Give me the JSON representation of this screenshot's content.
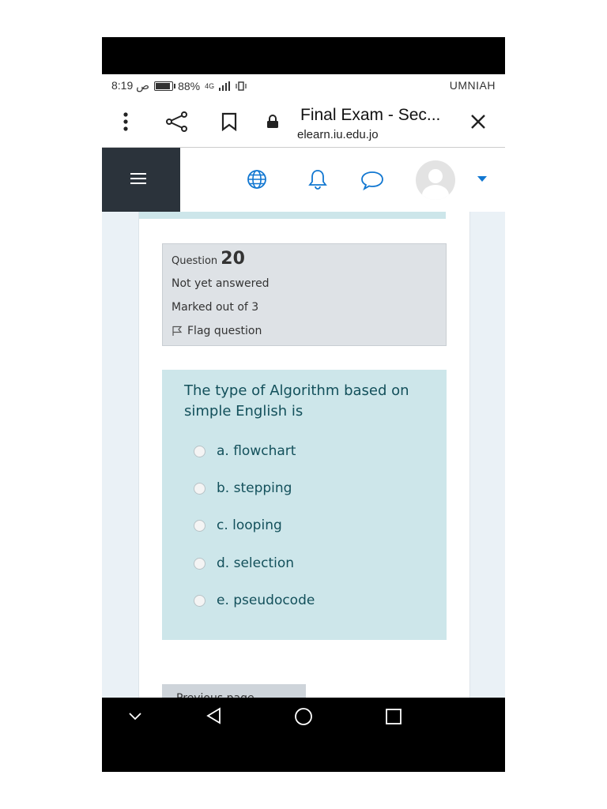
{
  "status_bar": {
    "time": "8:19 ص",
    "battery": "88%",
    "battery_level": 0.88,
    "network": "4G",
    "carrier": "UMNIAH"
  },
  "browser": {
    "page_title": "Final Exam - Sec...",
    "host": "elearn.iu.edu.jo",
    "icons": [
      "more-vert-icon",
      "share-icon",
      "bookmark-icon",
      "lock-icon",
      "close-icon"
    ]
  },
  "moodle_nav": {
    "icons": [
      "menu-icon",
      "globe-icon",
      "bell-icon",
      "chat-icon",
      "avatar",
      "caret-down-icon"
    ],
    "accent": "#1177d1"
  },
  "question": {
    "label": "Question",
    "number": "20",
    "state": "Not yet answered",
    "marks": "Marked out of 3",
    "flag": "Flag question",
    "text": "The type of Algorithm based on simple English is",
    "options": [
      {
        "label": "a. flowchart"
      },
      {
        "label": "b. stepping"
      },
      {
        "label": "c. looping"
      },
      {
        "label": "d. selection"
      },
      {
        "label": "e. pseudocode"
      }
    ]
  },
  "footer": {
    "prev_label": "Previous page"
  },
  "colors": {
    "info_bg": "#dee2e6",
    "qtext_bg": "#cde6ea",
    "qtext_fg": "#13505b",
    "nav_dark": "#2b333b"
  }
}
